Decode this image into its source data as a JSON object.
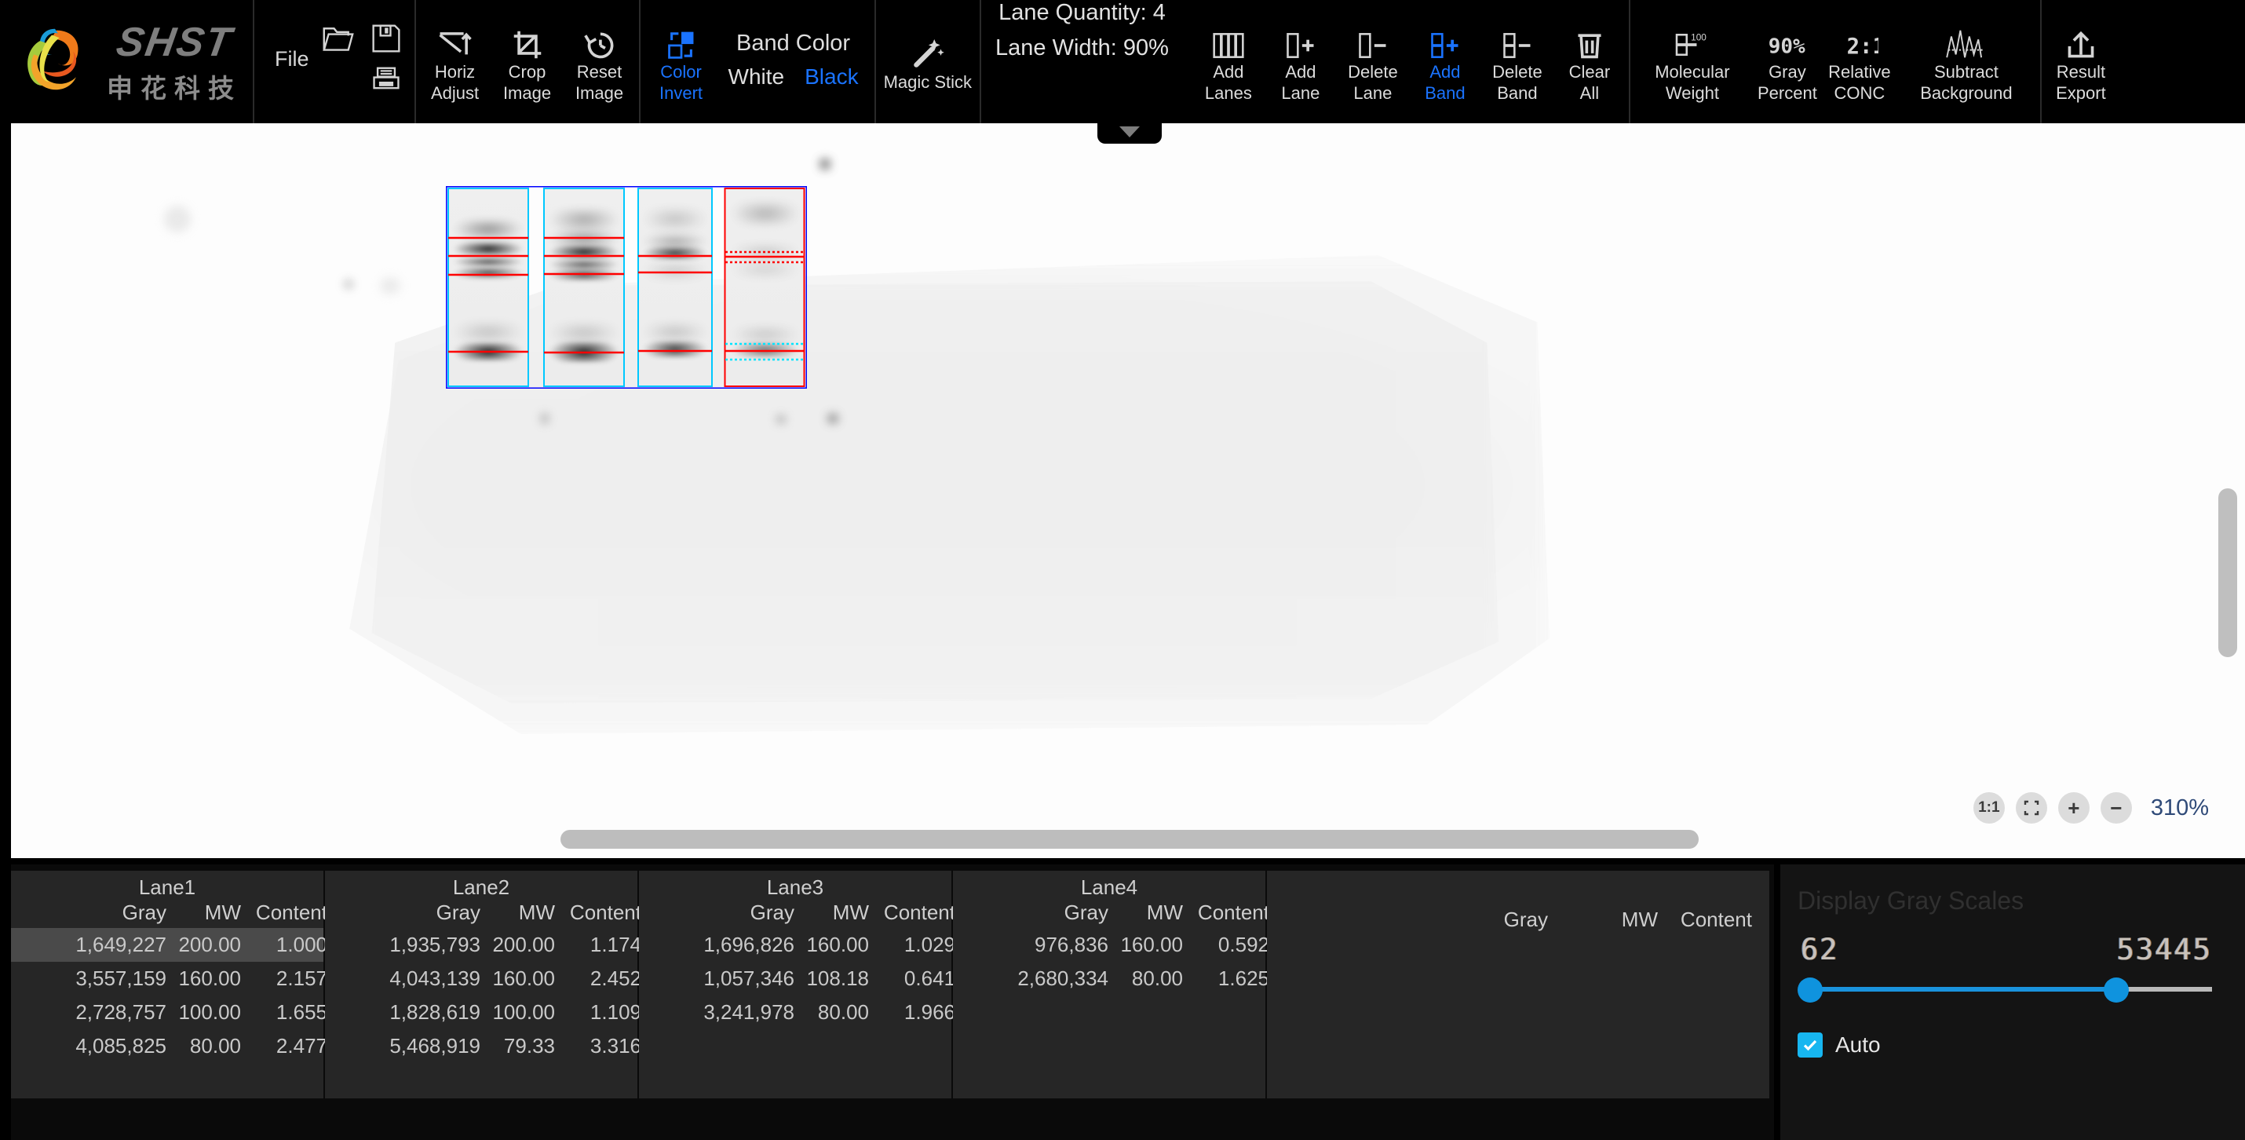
{
  "brand": {
    "wordmark": "SHST",
    "cn_name": "申花科技",
    "logo_icon": "shenhua-swirl-logo"
  },
  "toolbar": {
    "file": {
      "label": "File",
      "open_icon": "folder-open-icon",
      "save_icon": "floppy-disk-icon",
      "print_icon": "printer-icon"
    },
    "image_tools": [
      {
        "label_top": "Horiz",
        "label_bottom": "Adjust",
        "icon": "horizontal-adjust-icon"
      },
      {
        "label_top": "Crop",
        "label_bottom": "Image",
        "icon": "crop-icon"
      },
      {
        "label_top": "Reset",
        "label_bottom": "Image",
        "icon": "reset-clock-icon"
      }
    ],
    "color_invert": {
      "label_top": "Color",
      "label_bottom": "Invert",
      "icon": "color-invert-icon",
      "active": true
    },
    "band_color": {
      "title": "Band Color",
      "options": [
        "White",
        "Black"
      ],
      "selected": "Black"
    },
    "magic_stick": {
      "label": "Magic Stick",
      "icon": "magic-wand-icon"
    },
    "lane_quantity_label": "Lane Quantity: 4",
    "lane_width_label": "Lane Width: 90%",
    "lane_tools": [
      {
        "label_top": "Add",
        "label_bottom": "Lanes",
        "icon": "add-lanes-icon",
        "active": false
      },
      {
        "label_top": "Add",
        "label_bottom": "Lane",
        "icon": "add-lane-icon",
        "active": false
      },
      {
        "label_top": "Delete",
        "label_bottom": "Lane",
        "icon": "delete-lane-icon",
        "active": false
      },
      {
        "label_top": "Add",
        "label_bottom": "Band",
        "icon": "add-band-icon",
        "active": true
      },
      {
        "label_top": "Delete",
        "label_bottom": "Band",
        "icon": "delete-band-icon",
        "active": false
      },
      {
        "label_top": "Clear",
        "label_bottom": "All",
        "icon": "trash-icon",
        "active": false
      }
    ],
    "analysis_tools": [
      {
        "label_top": "Molecular",
        "label_bottom": "Weight",
        "icon": "molecular-weight-icon"
      },
      {
        "label_top": "Gray",
        "label_bottom": "Percent",
        "icon": "gray-percent-icon"
      },
      {
        "label_top": "Relative",
        "label_bottom": "CONC",
        "icon": "relative-conc-icon"
      },
      {
        "label_top": "Subtract",
        "label_bottom": "Background",
        "icon": "subtract-background-icon"
      }
    ],
    "export_tool": {
      "label_top": "Result",
      "label_bottom": "Export",
      "icon": "upload-export-icon"
    },
    "collapse_icon": "chevron-down-icon"
  },
  "viewer": {
    "zoom_controls": [
      {
        "label": "1:1",
        "icon": "one-to-one-icon"
      },
      {
        "label": "",
        "icon": "fit-screen-icon"
      },
      {
        "label": "+",
        "icon": "zoom-in-icon"
      },
      {
        "label": "−",
        "icon": "zoom-out-icon"
      }
    ],
    "zoom_percent": "310%",
    "accent_lane_border": "#00c8ff",
    "accent_selection_border": "#0000ff",
    "accent_band_marker": "#ff0000"
  },
  "tables": {
    "columns": [
      "Gray",
      "MW",
      "Content"
    ],
    "lanes": [
      {
        "title": "Lane1",
        "rows": [
          {
            "gray": "1,649,227",
            "mw": "200.00",
            "content": "1.000",
            "selected": true
          },
          {
            "gray": "3,557,159",
            "mw": "160.00",
            "content": "2.157",
            "selected": false
          },
          {
            "gray": "2,728,757",
            "mw": "100.00",
            "content": "1.655",
            "selected": false
          },
          {
            "gray": "4,085,825",
            "mw": "80.00",
            "content": "2.477",
            "selected": false
          }
        ]
      },
      {
        "title": "Lane2",
        "rows": [
          {
            "gray": "1,935,793",
            "mw": "200.00",
            "content": "1.174",
            "selected": false
          },
          {
            "gray": "4,043,139",
            "mw": "160.00",
            "content": "2.452",
            "selected": false
          },
          {
            "gray": "1,828,619",
            "mw": "100.00",
            "content": "1.109",
            "selected": false
          },
          {
            "gray": "5,468,919",
            "mw": "79.33",
            "content": "3.316",
            "selected": false
          }
        ]
      },
      {
        "title": "Lane3",
        "rows": [
          {
            "gray": "1,696,826",
            "mw": "160.00",
            "content": "1.029",
            "selected": false
          },
          {
            "gray": "1,057,346",
            "mw": "108.18",
            "content": "0.641",
            "selected": false
          },
          {
            "gray": "3,241,978",
            "mw": "80.00",
            "content": "1.966",
            "selected": false
          }
        ]
      },
      {
        "title": "Lane4",
        "rows": [
          {
            "gray": "976,836",
            "mw": "160.00",
            "content": "0.592",
            "selected": false
          },
          {
            "gray": "2,680,334",
            "mw": "80.00",
            "content": "1.625",
            "selected": false
          }
        ]
      },
      {
        "title": "",
        "rows": []
      }
    ]
  },
  "display_gray_scales": {
    "title": "Display Gray Scales",
    "min_value": "62",
    "max_value": "53445",
    "auto_label": "Auto",
    "auto_checked": true,
    "slider_color": "#0f93de",
    "check_icon": "checkmark-icon"
  }
}
